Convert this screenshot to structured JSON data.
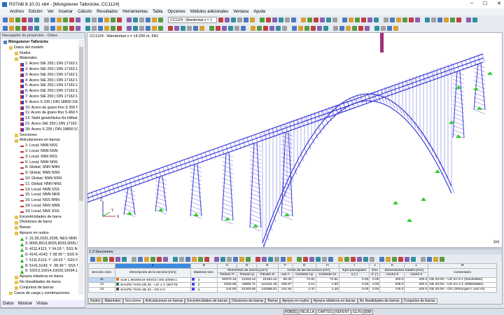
{
  "title": "RSTAB 8.10.01 x64 - [Müngstener Talbrücke, CC1124]",
  "menu": [
    "Archivo",
    "Edición",
    "Ver",
    "Insertar",
    "Cálculo",
    "Resultados",
    "Herramientas",
    "Tabla",
    "Opciones",
    "Módulos adicionales",
    "Ventana",
    "Ayuda"
  ],
  "toolbar": {
    "loadcase": "CC1124 - Wanderlast x = 1"
  },
  "navigator": {
    "title": "Navegador de proyectos - Datos",
    "items": [
      {
        "t": "Müngstener Talbrücke",
        "lvl": 0,
        "ic": "project"
      },
      {
        "t": "Datos del modelo",
        "lvl": 1,
        "ic": "folder"
      },
      {
        "t": "Nudos",
        "lvl": 2,
        "ic": "folder"
      },
      {
        "t": "Materiales",
        "lvl": 2,
        "ic": "folder"
      },
      {
        "t": "1: Acero StE 250 | DIN 17162:19",
        "lvl": 3,
        "ic": "mat"
      },
      {
        "t": "2: Acero StE 250 | DIN 17162:19",
        "lvl": 3,
        "ic": "mat"
      },
      {
        "t": "3: Acero StE 250 | DIN 17162:19",
        "lvl": 3,
        "ic": "mat"
      },
      {
        "t": "4: Acero StE 250 | DIN 17162:19",
        "lvl": 3,
        "ic": "mat"
      },
      {
        "t": "5: Acero StE 250 | DIN 17162:19",
        "lvl": 3,
        "ic": "mat"
      },
      {
        "t": "6: Acero StE 250 | DIN 17162:19",
        "lvl": 3,
        "ic": "mat"
      },
      {
        "t": "7: Acero StE 250 | DIN 17162:19",
        "lvl": 3,
        "ic": "mat"
      },
      {
        "t": "8: Acero S 235 | DIN 18800:1990",
        "lvl": 3,
        "ic": "mat"
      },
      {
        "t": "10: Acero de grano fino S 355 N",
        "lvl": 3,
        "ic": "mat"
      },
      {
        "t": "11: Acero de grano fino S 460 N",
        "lvl": 3,
        "ic": "mat"
      },
      {
        "t": "13: Stahl gewichtslos für Hilfsst",
        "lvl": 3,
        "ic": "mat"
      },
      {
        "t": "21: Acero StE 250 | DIN 17162:1",
        "lvl": 3,
        "ic": "mat"
      },
      {
        "t": "28: Acero S 235 | DIN 18800:199",
        "lvl": 3,
        "ic": "mat"
      },
      {
        "t": "Secciones",
        "lvl": 2,
        "ic": "folder"
      },
      {
        "t": "Articulaciones en barras",
        "lvl": 2,
        "ic": "folder"
      },
      {
        "t": "1: Local; NNN NSS",
        "lvl": 3,
        "ic": "hinge"
      },
      {
        "t": "2: Local; NNN NSN",
        "lvl": 3,
        "ic": "hinge"
      },
      {
        "t": "3: Local; SNN NSS",
        "lvl": 3,
        "ic": "hinge"
      },
      {
        "t": "5: Local; NNN NNS",
        "lvl": 3,
        "ic": "hinge"
      },
      {
        "t": "8: Global; SNN NNN",
        "lvl": 3,
        "ic": "hinge"
      },
      {
        "t": "9: Global; NNN NSN",
        "lvl": 3,
        "ic": "hinge"
      },
      {
        "t": "10: Global; NNN NSN",
        "lvl": 3,
        "ic": "hinge"
      },
      {
        "t": "11: Global; NNN NNS",
        "lvl": 3,
        "ic": "hinge"
      },
      {
        "t": "13: Local; NNN SSS",
        "lvl": 3,
        "ic": "hinge"
      },
      {
        "t": "15: Local; NNN NEN",
        "lvl": 3,
        "ic": "hinge"
      },
      {
        "t": "16: Local; NSS NNN",
        "lvl": 3,
        "ic": "hinge"
      },
      {
        "t": "18: Local; NNS NNN",
        "lvl": 3,
        "ic": "hinge"
      },
      {
        "t": "19: Local; NNS SSS",
        "lvl": 3,
        "ic": "hinge"
      },
      {
        "t": "Excentricidades de barra",
        "lvl": 2,
        "ic": "folder"
      },
      {
        "t": "Divisiones de barra",
        "lvl": 2,
        "ic": "folder"
      },
      {
        "t": "Barras",
        "lvl": 2,
        "ic": "folder"
      },
      {
        "t": "Apoyos en nudos",
        "lvl": 2,
        "ic": "folder"
      },
      {
        "t": "1: 31,36,2031,2036; NES NNN",
        "lvl": 3,
        "ic": "sup"
      },
      {
        "t": "3: 8006,8013,8026,8033,9006,90",
        "lvl": 3,
        "ic": "sup"
      },
      {
        "t": "5: 4111,4113; Y 34.03 °; SSS NN",
        "lvl": 3,
        "ic": "sup"
      },
      {
        "t": "6: 4141,4143; Y 38.39 °; SSS NN",
        "lvl": 3,
        "ic": "sup"
      },
      {
        "t": "7: 5111,5113; Y -34.03 °; SSS N",
        "lvl": 3,
        "ic": "sup"
      },
      {
        "t": "8: 5141,5143; Y -38.39 °; SSS N",
        "lvl": 3,
        "ic": "sup"
      },
      {
        "t": "9: 10013,10014,10033,10034,11",
        "lvl": 3,
        "ic": "sup"
      },
      {
        "t": "Apoyos elásticos en barra",
        "lvl": 2,
        "ic": "folder"
      },
      {
        "t": "No linealidades de barra",
        "lvl": 2,
        "ic": "folder"
      },
      {
        "t": "Conjuntos de barras",
        "lvl": 2,
        "ic": "folder"
      },
      {
        "t": "Casos de carga y combinaciones",
        "lvl": 1,
        "ic": "folder"
      }
    ],
    "tabs": [
      "Datos",
      "Mostrar",
      "Vistas"
    ]
  },
  "view": {
    "label": "CC1124 : Wanderlast x = 14.200 m, FA1",
    "unit": "[m]",
    "axes": [
      "X",
      "Y",
      "Z"
    ]
  },
  "panel": {
    "title": "1.3 Secciones",
    "col_letters": [
      "A",
      "B",
      "C",
      "D",
      "E",
      "F",
      "G",
      "H",
      "I",
      "J",
      "K",
      "L",
      "M"
    ],
    "headers": {
      "sec": "Sección núm.",
      "desc": "Descripción de la sección [mm]",
      "mat": "Material núm.",
      "mom": "Momentos de inercia [cm⁴]",
      "tor": "Torsión IT",
      "fy": "Flexión Iy",
      "fz": "Flexión Iz",
      "areas": "Áreas de las secciones [cm²]",
      "axil": "Axil A",
      "cy": "Cortante Ay",
      "cz": "Cortante Az",
      "ejes": "Ejes principales",
      "alpha": "α [°]",
      "giro": "Giro",
      "alpha2": "α' [°]",
      "dims": "Dimensiones totales [mm]",
      "ancho": "Ancho b",
      "canto": "Canto h",
      "coment": "Comentario"
    },
    "rows": [
      {
        "n": "11",
        "color": "#e07020",
        "d": "4LM L 90x90x10-400/10 | EN 10056-1",
        "m": "2",
        "it": "59370.16",
        "iy": "21264.42",
        "iz": "21264.42",
        "a": "68.40",
        "ay": "72.81",
        "az": "72.81",
        "al": "0.00",
        "al2": "0.00",
        "b": "400.0",
        "h": "400.0",
        "c": "GB 30.0m - UG Kn 0-1 (Randstäbe)"
      },
      {
        "n": "12",
        "color": "#208070",
        "d": "SHAPE-THIN GB 30 - UG 1-1' (MITTE",
        "m": "2",
        "it": "9165.55",
        "iy": "43965.71",
        "iz": "112341.48",
        "a": "206.97",
        "ay": "3.14",
        "az": "1.80",
        "al": "0.00",
        "al2": "0.00",
        "b": "636.0",
        "h": "400.0",
        "c": "GB 30.0m - UG Kn 1-1' (Mittelstäbe)"
      },
      {
        "n": "13",
        "color": "#555555",
        "d": "SHAPE-THIN GB 30 - OG 0-II",
        "m": "2",
        "it": "144.90",
        "iy": "51400.65",
        "iz": "142659.51",
        "a": "241.92",
        "ay": "2.47",
        "az": "1.48",
        "al": "0.00",
        "al2": "0.00",
        "b": "716.0",
        "h": "400.0",
        "c": "GB 30.0m - OG (Öffnungen I und VII)"
      }
    ],
    "tabs": [
      "Nudos",
      "Materiales",
      "Secciones",
      "Articulaciones en barras",
      "Excentricidades de barras",
      "Divisiones de barras",
      "Barras",
      "Apoyos en nudos",
      "Apoyos elásticos en barras",
      "No linealidades de barras",
      "Conjuntos de barras"
    ],
    "active_tab": "Secciones"
  },
  "status": [
    "FORZC",
    "REJILLA",
    "CARTES",
    "REFENT",
    "GLIN",
    "DXF"
  ],
  "colors": {
    "structure": "#3a3ad8",
    "support": "#33cc33",
    "accent": "#2a6fc0"
  }
}
